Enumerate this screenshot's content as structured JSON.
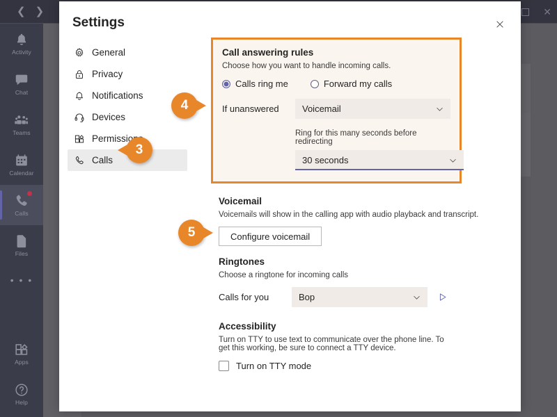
{
  "window": {
    "back_icon": "chevron-left-icon",
    "forward_icon": "chevron-right-icon",
    "restore_label": "",
    "close_label": "✕"
  },
  "rail": {
    "items": [
      {
        "label": "Activity",
        "icon": "bell-icon",
        "active": false,
        "badge": false
      },
      {
        "label": "Chat",
        "icon": "chat-icon",
        "active": false,
        "badge": false
      },
      {
        "label": "Teams",
        "icon": "teams-icon",
        "active": false,
        "badge": false
      },
      {
        "label": "Calendar",
        "icon": "calendar-icon",
        "active": false,
        "badge": false
      },
      {
        "label": "Calls",
        "icon": "phone-icon",
        "active": true,
        "badge": true
      },
      {
        "label": "Files",
        "icon": "file-icon",
        "active": false,
        "badge": false
      }
    ],
    "more_label": "• • •",
    "bottom": [
      {
        "label": "Apps",
        "icon": "apps-icon"
      },
      {
        "label": "Help",
        "icon": "help-icon"
      }
    ]
  },
  "background": {
    "row_menu_label": "•••"
  },
  "modal": {
    "title": "Settings",
    "close_icon": "close-icon",
    "nav": [
      {
        "label": "General",
        "icon": "gear-icon",
        "selected": false
      },
      {
        "label": "Privacy",
        "icon": "lock-icon",
        "selected": false
      },
      {
        "label": "Notifications",
        "icon": "bell-icon",
        "selected": false
      },
      {
        "label": "Devices",
        "icon": "headset-icon",
        "selected": false
      },
      {
        "label": "Permissions",
        "icon": "permissions-icon",
        "selected": false
      },
      {
        "label": "Calls",
        "icon": "phone-icon",
        "selected": true
      }
    ]
  },
  "call_answering_rules": {
    "heading": "Call answering rules",
    "description": "Choose how you want to handle incoming calls.",
    "option_ring": "Calls ring me",
    "option_forward": "Forward my calls",
    "selected_option": "Calls ring me",
    "if_unanswered_label": "If unanswered",
    "if_unanswered_value": "Voicemail",
    "ring_seconds_note": "Ring for this many seconds before redirecting",
    "ring_seconds_value": "30 seconds"
  },
  "voicemail": {
    "heading": "Voicemail",
    "description": "Voicemails will show in the calling app with audio playback and transcript.",
    "configure_button": "Configure voicemail"
  },
  "ringtones": {
    "heading": "Ringtones",
    "description": "Choose a ringtone for incoming calls",
    "calls_for_you_label": "Calls for you",
    "calls_for_you_value": "Bop",
    "play_icon": "play-icon"
  },
  "accessibility": {
    "heading": "Accessibility",
    "description": "Turn on TTY to use text to communicate over the phone line. To get this working, be sure to connect a TTY device.",
    "tty_label": "Turn on TTY mode",
    "tty_checked": false
  },
  "callouts": [
    {
      "number": "3",
      "target": "calls-nav-item"
    },
    {
      "number": "4",
      "target": "call-answering-rules-box"
    },
    {
      "number": "5",
      "target": "configure-voicemail-button"
    }
  ],
  "colors": {
    "accent_orange": "#E8862A",
    "teams_purple": "#6264A7",
    "rail_dark": "#3B3C4A",
    "titlebar_dark": "#33343F",
    "badge_red": "#C4314B",
    "rules_bg": "#FBF5EF"
  }
}
